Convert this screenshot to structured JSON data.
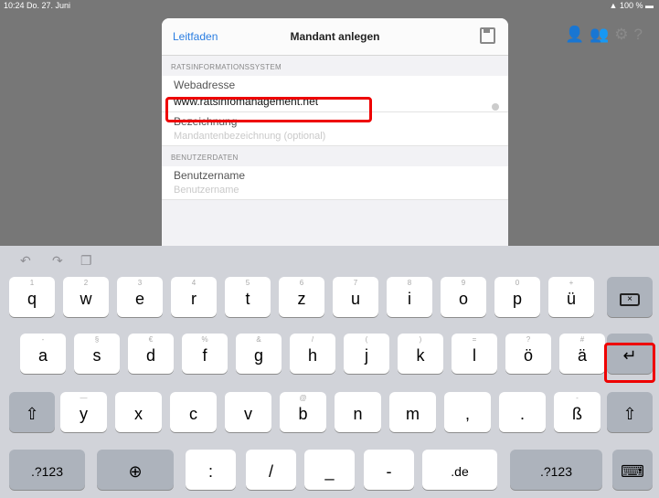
{
  "status_bar": {
    "time": "10:24  Do. 27. Juni",
    "battery": "100 %"
  },
  "header_icons": [
    "person-add-icon",
    "person-group-icon",
    "settings-icon",
    "help-icon"
  ],
  "modal": {
    "left_button": "Leitfaden",
    "title": "Mandant anlegen",
    "save_icon": "save-icon",
    "section1": "RATSINFORMATIONSSYSTEM",
    "fields": [
      {
        "label": "Webadresse",
        "value": "www.ratsinfomanagement.net"
      },
      {
        "label": "Bezeichnung",
        "placeholder": "Mandantenbezeichnung (optional)"
      }
    ],
    "section2": "BENUTZERDATEN",
    "fields2": [
      {
        "label": "Benutzername",
        "placeholder": "Benutzername"
      }
    ]
  },
  "keyboard": {
    "toolbar": [
      "undo-icon",
      "redo-icon",
      "paste-icon"
    ],
    "row1": [
      {
        "k": "q",
        "h": "1"
      },
      {
        "k": "w",
        "h": "2"
      },
      {
        "k": "e",
        "h": "3"
      },
      {
        "k": "r",
        "h": "4"
      },
      {
        "k": "t",
        "h": "5"
      },
      {
        "k": "z",
        "h": "6"
      },
      {
        "k": "u",
        "h": "7"
      },
      {
        "k": "i",
        "h": "8"
      },
      {
        "k": "o",
        "h": "9"
      },
      {
        "k": "p",
        "h": "0"
      },
      {
        "k": "ü",
        "h": "+"
      }
    ],
    "row2": [
      {
        "k": "a",
        "h": "-"
      },
      {
        "k": "s",
        "h": "§"
      },
      {
        "k": "d",
        "h": "€"
      },
      {
        "k": "f",
        "h": "%"
      },
      {
        "k": "g",
        "h": "&"
      },
      {
        "k": "h",
        "h": "/"
      },
      {
        "k": "j",
        "h": "("
      },
      {
        "k": "k",
        "h": ")"
      },
      {
        "k": "l",
        "h": "="
      },
      {
        "k": "ö",
        "h": "?"
      },
      {
        "k": "ä",
        "h": "#"
      }
    ],
    "row3": [
      {
        "k": "y",
        "h": "—"
      },
      {
        "k": "x",
        "h": ""
      },
      {
        "k": "c",
        "h": ""
      },
      {
        "k": "v",
        "h": ""
      },
      {
        "k": "b",
        "h": "@"
      },
      {
        "k": "n",
        "h": ""
      },
      {
        "k": "m",
        "h": ""
      },
      {
        "k": ",",
        "h": ""
      },
      {
        "k": ".",
        "h": ""
      },
      {
        "k": "ß",
        "h": "-"
      }
    ],
    "row4": {
      "numbers": ".?123",
      "globe": "globe-icon",
      "colon": ":",
      "slash": "/",
      "underscore": "_",
      "dash": "-",
      "domain": ".de",
      "numbers2": ".?123",
      "hide": "keyboard-hide-icon"
    }
  }
}
